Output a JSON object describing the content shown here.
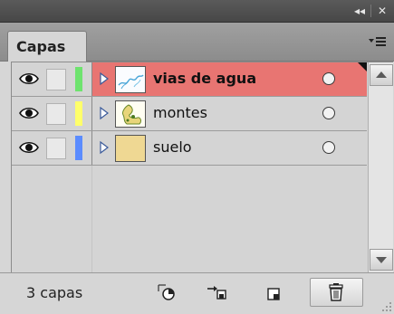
{
  "titlebar": {
    "collapse_icon": "double-chevron-left-icon",
    "collapse_label": "◂◂",
    "close_icon": "close-icon",
    "close_label": "✕"
  },
  "panel": {
    "tab_label": "Capas",
    "menu_icon": "panel-menu-icon"
  },
  "layers": [
    {
      "name": "vias de agua",
      "color": "#6ee36e",
      "selected": true,
      "thumbnail": "water-thumbnail"
    },
    {
      "name": "montes",
      "color": "#ffff6a",
      "selected": false,
      "thumbnail": "mountains-thumbnail"
    },
    {
      "name": "suelo",
      "color": "#5b8cff",
      "selected": false,
      "thumbnail": "soil-thumbnail"
    }
  ],
  "footer": {
    "layer_count": "3 capas",
    "icons": [
      "locate-object-icon",
      "make-clipping-mask-icon",
      "new-sublayer-icon",
      "new-layer-icon",
      "delete-layer-icon"
    ]
  },
  "colors": {
    "selected_row": "#e87572",
    "titlebar": "#4f4f4f",
    "panel_bg": "#d6d6d6"
  }
}
